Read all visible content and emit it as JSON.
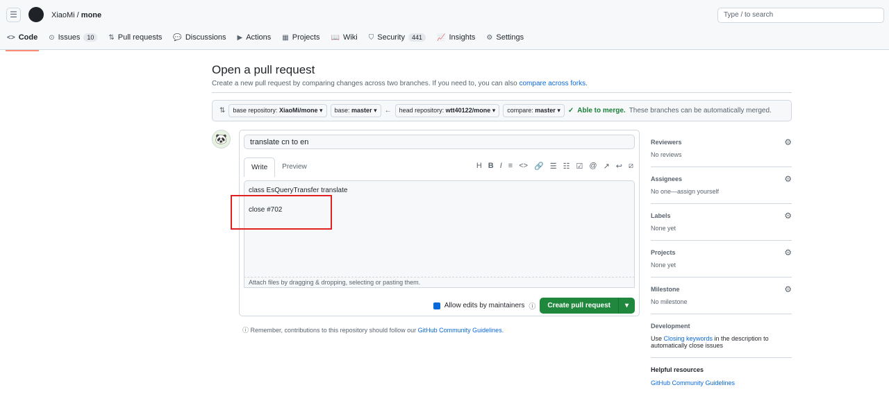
{
  "header": {
    "owner": "XiaoMi",
    "repo": "mone",
    "search_placeholder": "Type / to search"
  },
  "tabs": [
    {
      "label": "Code",
      "icon": "code-icon",
      "g": "<>"
    },
    {
      "label": "Issues",
      "count": "10",
      "icon": "issue-icon",
      "g": "⊙"
    },
    {
      "label": "Pull requests",
      "icon": "pr-icon",
      "g": "⇅"
    },
    {
      "label": "Discussions",
      "icon": "discussion-icon",
      "g": "💬"
    },
    {
      "label": "Actions",
      "icon": "play-icon",
      "g": "▶"
    },
    {
      "label": "Projects",
      "icon": "table-icon",
      "g": "▦"
    },
    {
      "label": "Wiki",
      "icon": "book-icon",
      "g": "📖"
    },
    {
      "label": "Security",
      "count": "441",
      "icon": "shield-icon",
      "g": "⛉"
    },
    {
      "label": "Insights",
      "icon": "graph-icon",
      "g": "📈"
    },
    {
      "label": "Settings",
      "icon": "gear-icon",
      "g": "⚙"
    }
  ],
  "page": {
    "title": "Open a pull request",
    "subtitle": "Create a new pull request by comparing changes across two branches. If you need to, you can also ",
    "subtitle_link": "compare across forks."
  },
  "range": {
    "base_repo_label": "base repository:",
    "base_repo": "XiaoMi/mone",
    "base_label": "base:",
    "base": "master",
    "head_repo_label": "head repository:",
    "head_repo": "wtt40122/mone",
    "compare_label": "compare:",
    "compare": "master",
    "merge_status": "Able to merge.",
    "merge_text": "These branches can be automatically merged."
  },
  "form": {
    "title": "translate cn to en",
    "tab_write": "Write",
    "tab_preview": "Preview",
    "body_line1": "class EsQueryTransfer translate",
    "body_line2": "close #702",
    "attach": "Attach files by dragging & dropping, selecting or pasting them.",
    "allow_edits": "Allow edits by maintainers",
    "create": "Create pull request"
  },
  "note": {
    "text": "Remember, contributions to this repository should follow our ",
    "link": "GitHub Community Guidelines."
  },
  "sidebar": [
    {
      "h": "Reviewers",
      "v": "No reviews"
    },
    {
      "h": "Assignees",
      "v": "No one—assign yourself"
    },
    {
      "h": "Labels",
      "v": "None yet"
    },
    {
      "h": "Projects",
      "v": "None yet"
    },
    {
      "h": "Milestone",
      "v": "No milestone"
    }
  ],
  "development": {
    "h": "Development",
    "pre": "Use ",
    "link": "Closing keywords",
    "post": " in the description to automatically close issues"
  },
  "help": {
    "h": "Helpful resources",
    "link": "GitHub Community Guidelines"
  }
}
